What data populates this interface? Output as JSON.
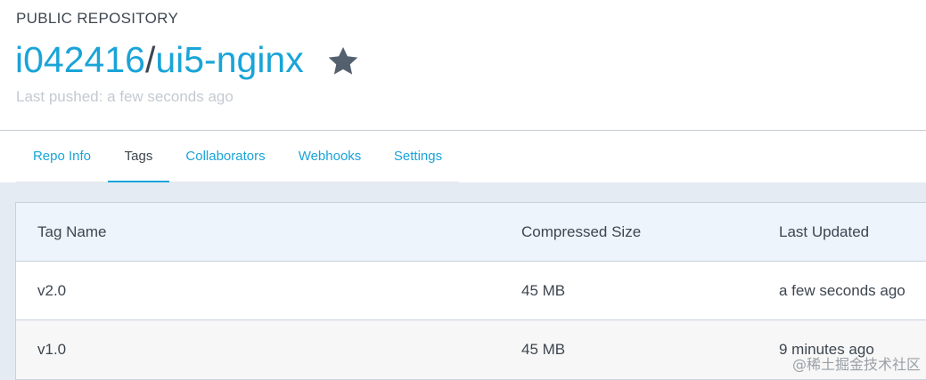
{
  "header": {
    "repo_type": "PUBLIC REPOSITORY",
    "owner": "i042416",
    "separator": "/",
    "repo_name": "ui5-nginx",
    "star_icon": "star-icon",
    "last_pushed": "Last pushed: a few seconds ago"
  },
  "tabs": [
    {
      "label": "Repo Info",
      "active": false
    },
    {
      "label": "Tags",
      "active": true
    },
    {
      "label": "Collaborators",
      "active": false
    },
    {
      "label": "Webhooks",
      "active": false
    },
    {
      "label": "Settings",
      "active": false
    }
  ],
  "table": {
    "columns": [
      "Tag Name",
      "Compressed Size",
      "Last Updated"
    ],
    "rows": [
      {
        "tag": "v2.0",
        "size": "45 MB",
        "updated": "a few seconds ago"
      },
      {
        "tag": "v1.0",
        "size": "45 MB",
        "updated": "9 minutes ago"
      }
    ]
  },
  "watermark": "@稀土掘金技术社区",
  "colors": {
    "accent": "#1aa4d8",
    "text": "#3d4650",
    "muted": "#c4cad1",
    "star": "#55606e",
    "content_bg": "#e5ebf2"
  }
}
